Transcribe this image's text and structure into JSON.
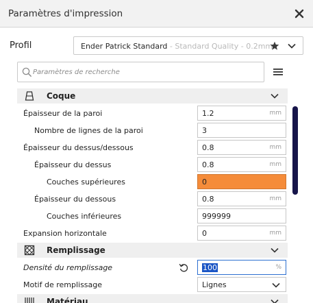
{
  "window": {
    "title": "Paramètres d'impression"
  },
  "profile": {
    "label": "Profil",
    "name": "Ender Patrick Standard",
    "quality": "- Standard Quality - 0.2mm"
  },
  "search": {
    "placeholder": "Paramètres de recherche"
  },
  "categories": {
    "shell": {
      "label": "Coque",
      "icon": "shell-icon"
    },
    "infill": {
      "label": "Remplissage",
      "icon": "infill-icon"
    },
    "material": {
      "label": "Matériau",
      "icon": "material-icon"
    }
  },
  "settings": {
    "wall_thickness": {
      "label": "Épaisseur de la paroi",
      "value": "1.2",
      "unit": "mm"
    },
    "wall_line_count": {
      "label": "Nombre de lignes de la paroi",
      "value": "3"
    },
    "top_bottom_thickness": {
      "label": "Épaisseur du dessus/dessous",
      "value": "0.8",
      "unit": "mm"
    },
    "top_thickness": {
      "label": "Épaisseur du dessus",
      "value": "0.8",
      "unit": "mm"
    },
    "top_layers": {
      "label": "Couches supérieures",
      "value": "0"
    },
    "bottom_thickness": {
      "label": "Épaisseur du dessous",
      "value": "0.8",
      "unit": "mm"
    },
    "bottom_layers": {
      "label": "Couches inférieures",
      "value": "999999"
    },
    "horizontal_expansion": {
      "label": "Expansion horizontale",
      "value": "0",
      "unit": "mm"
    },
    "infill_density": {
      "label": "Densité du remplissage",
      "value": "100",
      "unit": "%"
    },
    "infill_pattern": {
      "label": "Motif de remplissage",
      "value": "Lignes"
    }
  },
  "colors": {
    "warning_field": "#f58c3a",
    "scrollbar": "#17154a",
    "selection": "#1a55c5"
  }
}
